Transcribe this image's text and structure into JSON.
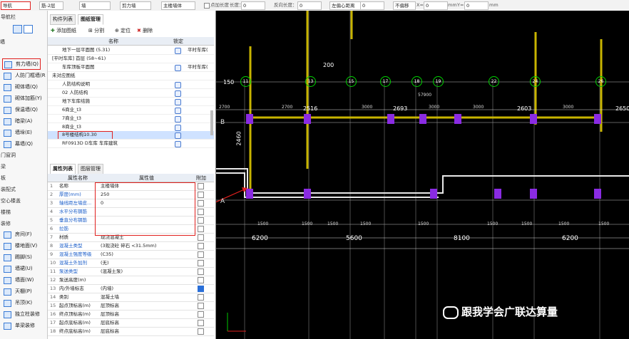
{
  "toolbar": {
    "layer_select": "筋-2层",
    "type_select": "墙",
    "category_select": "剪力墙",
    "element_select": "主楼墙体",
    "pt_length_label": "点加长度",
    "length_label": "长度：",
    "length_value": "0",
    "reverse_length_label": "反向长度：",
    "reverse_length_value": "0",
    "offset_mode": "左偏心距离",
    "offset_value": "0",
    "no_offset": "不偏移",
    "x_label": "X=",
    "x_value": "0",
    "unit_mm_1": "mm",
    "y_label": "Y=",
    "y_value": "0",
    "unit_mm_2": "mm"
  },
  "sidebar": {
    "top_label": "导航栏",
    "items": [
      {
        "label": "剪力墙(Q)",
        "highlighted": true
      },
      {
        "label": "人防门框墙(R"
      },
      {
        "label": "砌体墙(Q)"
      },
      {
        "label": "砌体加筋(Y)"
      },
      {
        "label": "保温墙(Q)"
      },
      {
        "label": "暗梁(A)"
      },
      {
        "label": "墙垛(E)"
      },
      {
        "label": "幕墙(Q)"
      }
    ],
    "section_labels": [
      "门窗洞",
      "梁",
      "板",
      "装配式",
      "空心楼盖",
      "楼梯",
      "装修"
    ],
    "items2": [
      {
        "label": "房间(F)"
      },
      {
        "label": "楼地面(V)"
      },
      {
        "label": "踢脚(S)"
      },
      {
        "label": "墙裙(U)"
      },
      {
        "label": "墙面(W)"
      },
      {
        "label": "天棚(P)"
      },
      {
        "label": "吊顶(K)"
      },
      {
        "label": "独立柱装修"
      },
      {
        "label": "单梁装修"
      }
    ]
  },
  "midpanel": {
    "tabs": [
      "构件列表",
      "图纸管理"
    ],
    "actions": {
      "add": "添加图纸",
      "split": "分割",
      "locate": "定位",
      "delete": "删除"
    },
    "table_headers": {
      "name": "名称",
      "lock": "锁定"
    },
    "drawings": [
      {
        "num": "",
        "name": "地下一层平面图 (5.31)",
        "extra": "平时车库("
      },
      {
        "num": "",
        "name": "[平时车库] 首层 (58~61)",
        "extra": ""
      },
      {
        "num": "",
        "name": "车库顶板平面图",
        "extra": "平时车库("
      },
      {
        "num": "",
        "name": "未对应图纸",
        "extra": ""
      },
      {
        "num": "",
        "name": "人防结构说明",
        "extra": ""
      },
      {
        "num": "",
        "name": "02 人防结构",
        "extra": ""
      },
      {
        "num": "",
        "name": "地下车库结施",
        "extra": ""
      },
      {
        "num": "",
        "name": "6商业_t3",
        "extra": ""
      },
      {
        "num": "",
        "name": "7商业_t3",
        "extra": ""
      },
      {
        "num": "",
        "name": "8商业_t3",
        "extra": ""
      },
      {
        "num": "",
        "name": "8号楼结构10.30",
        "extra": "",
        "selected": true
      },
      {
        "num": "",
        "name": "RF0913D D车库 车库建筑",
        "extra": ""
      }
    ],
    "prop_tabs": [
      "属性列表",
      "图层管理"
    ],
    "prop_headers": {
      "name": "属性名称",
      "value": "属性值",
      "attach": "附加"
    },
    "props": [
      {
        "num": "1",
        "name": "名称",
        "value": "主楼墙体",
        "checked": false
      },
      {
        "num": "2",
        "name": "厚度(mm)",
        "value": "250",
        "checked": false
      },
      {
        "num": "3",
        "name": "轴线距左墙皮...",
        "value": "0",
        "checked": false
      },
      {
        "num": "4",
        "name": "水平分布钢筋",
        "value": "",
        "checked": false
      },
      {
        "num": "5",
        "name": "垂直分布钢筋",
        "value": "",
        "checked": false
      },
      {
        "num": "6",
        "name": "拉筋",
        "value": "",
        "checked": false
      },
      {
        "num": "7",
        "name": "材质",
        "value": "现浇混凝土",
        "checked": false
      },
      {
        "num": "8",
        "name": "混凝土类型",
        "value": "(3现浇砼 碎石 <31.5mm)",
        "checked": false
      },
      {
        "num": "9",
        "name": "混凝土强度等级",
        "value": "(C35)",
        "checked": false
      },
      {
        "num": "10",
        "name": "混凝土外加剂",
        "value": "(无)",
        "checked": false
      },
      {
        "num": "11",
        "name": "泵送类型",
        "value": "(混凝土泵)",
        "checked": false
      },
      {
        "num": "12",
        "name": "泵送高度(m)",
        "value": "",
        "checked": false
      },
      {
        "num": "13",
        "name": "内/外墙标志",
        "value": "(内墙)",
        "checked": true
      },
      {
        "num": "14",
        "name": "类别",
        "value": "混凝土墙",
        "checked": false
      },
      {
        "num": "15",
        "name": "起点顶标高(m)",
        "value": "层顶标高",
        "checked": false
      },
      {
        "num": "16",
        "name": "终点顶标高(m)",
        "value": "层顶标高",
        "checked": false
      },
      {
        "num": "17",
        "name": "起点底标高(m)",
        "value": "层底标高",
        "checked": false
      },
      {
        "num": "18",
        "name": "终点底标高(m)",
        "value": "层底标高",
        "checked": false
      }
    ]
  },
  "canvas": {
    "top_dims": [
      "200",
      "2516",
      "2693",
      "2603",
      "2650"
    ],
    "axis_numbers": [
      "11",
      "13",
      "15",
      "17",
      "18",
      "19",
      "22",
      "24",
      "26"
    ],
    "left_labels": {
      "b": "B",
      "a": "A",
      "top_val": "150",
      "side_val": "2460"
    },
    "span_text": "57900",
    "bottom_dims": [
      "6200",
      "5600",
      "8100",
      "6200"
    ],
    "small_dims": [
      "1500",
      "1500",
      "1500",
      "1500",
      "1500",
      "1500",
      "1500",
      "1500",
      "1500"
    ],
    "mid_small": [
      "2700",
      "2700",
      "3000",
      "3000",
      "3000",
      "3000"
    ],
    "watermark": "跟我学会广联达算量"
  },
  "colors": {
    "accent": "#e0201e",
    "wall_yellow": "#c8b400",
    "bubble_green": "#00c800"
  }
}
